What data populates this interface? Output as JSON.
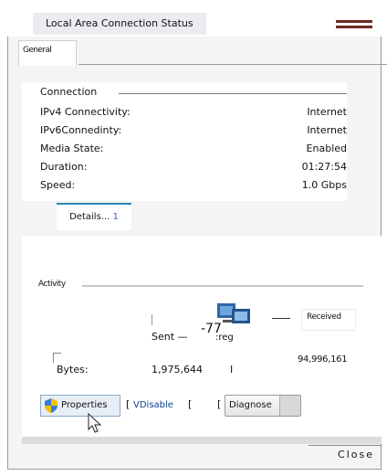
{
  "window": {
    "title": "Local Area Connection Status"
  },
  "tabs": {
    "general": "General"
  },
  "connection": {
    "heading": "Connection",
    "rows": [
      {
        "label": "IPv4 Connectivity:",
        "value": "Internet"
      },
      {
        "label": "IPv6Connedinty:",
        "value": "Internet"
      },
      {
        "label": "Media State:",
        "value": "Enabled"
      },
      {
        "label": "Duration:",
        "value": "01:27:54"
      },
      {
        "label": "Speed:",
        "value": "1.0 Gbps"
      }
    ],
    "details_label": "Details...",
    "details_num": "1"
  },
  "activity": {
    "heading": "Activity",
    "sent_label": "Sent —",
    "sent_num": "-77",
    "sent_suffix": ":reg",
    "received_label": "Received",
    "bytes_label": "Bytes:",
    "bytes_sent": "1,975,644",
    "bytes_mid": "I",
    "bytes_received": "94,996,161"
  },
  "buttons": {
    "properties": "Properties",
    "sep1": "[",
    "disable": "VDisable",
    "sep2": "[",
    "sep3": "[",
    "diagnose": "Diagnose",
    "close": "Close"
  },
  "icons": {
    "shield": "shield-icon",
    "network": "network-adapter-icon",
    "cursor": "mouse-pointer-icon"
  }
}
